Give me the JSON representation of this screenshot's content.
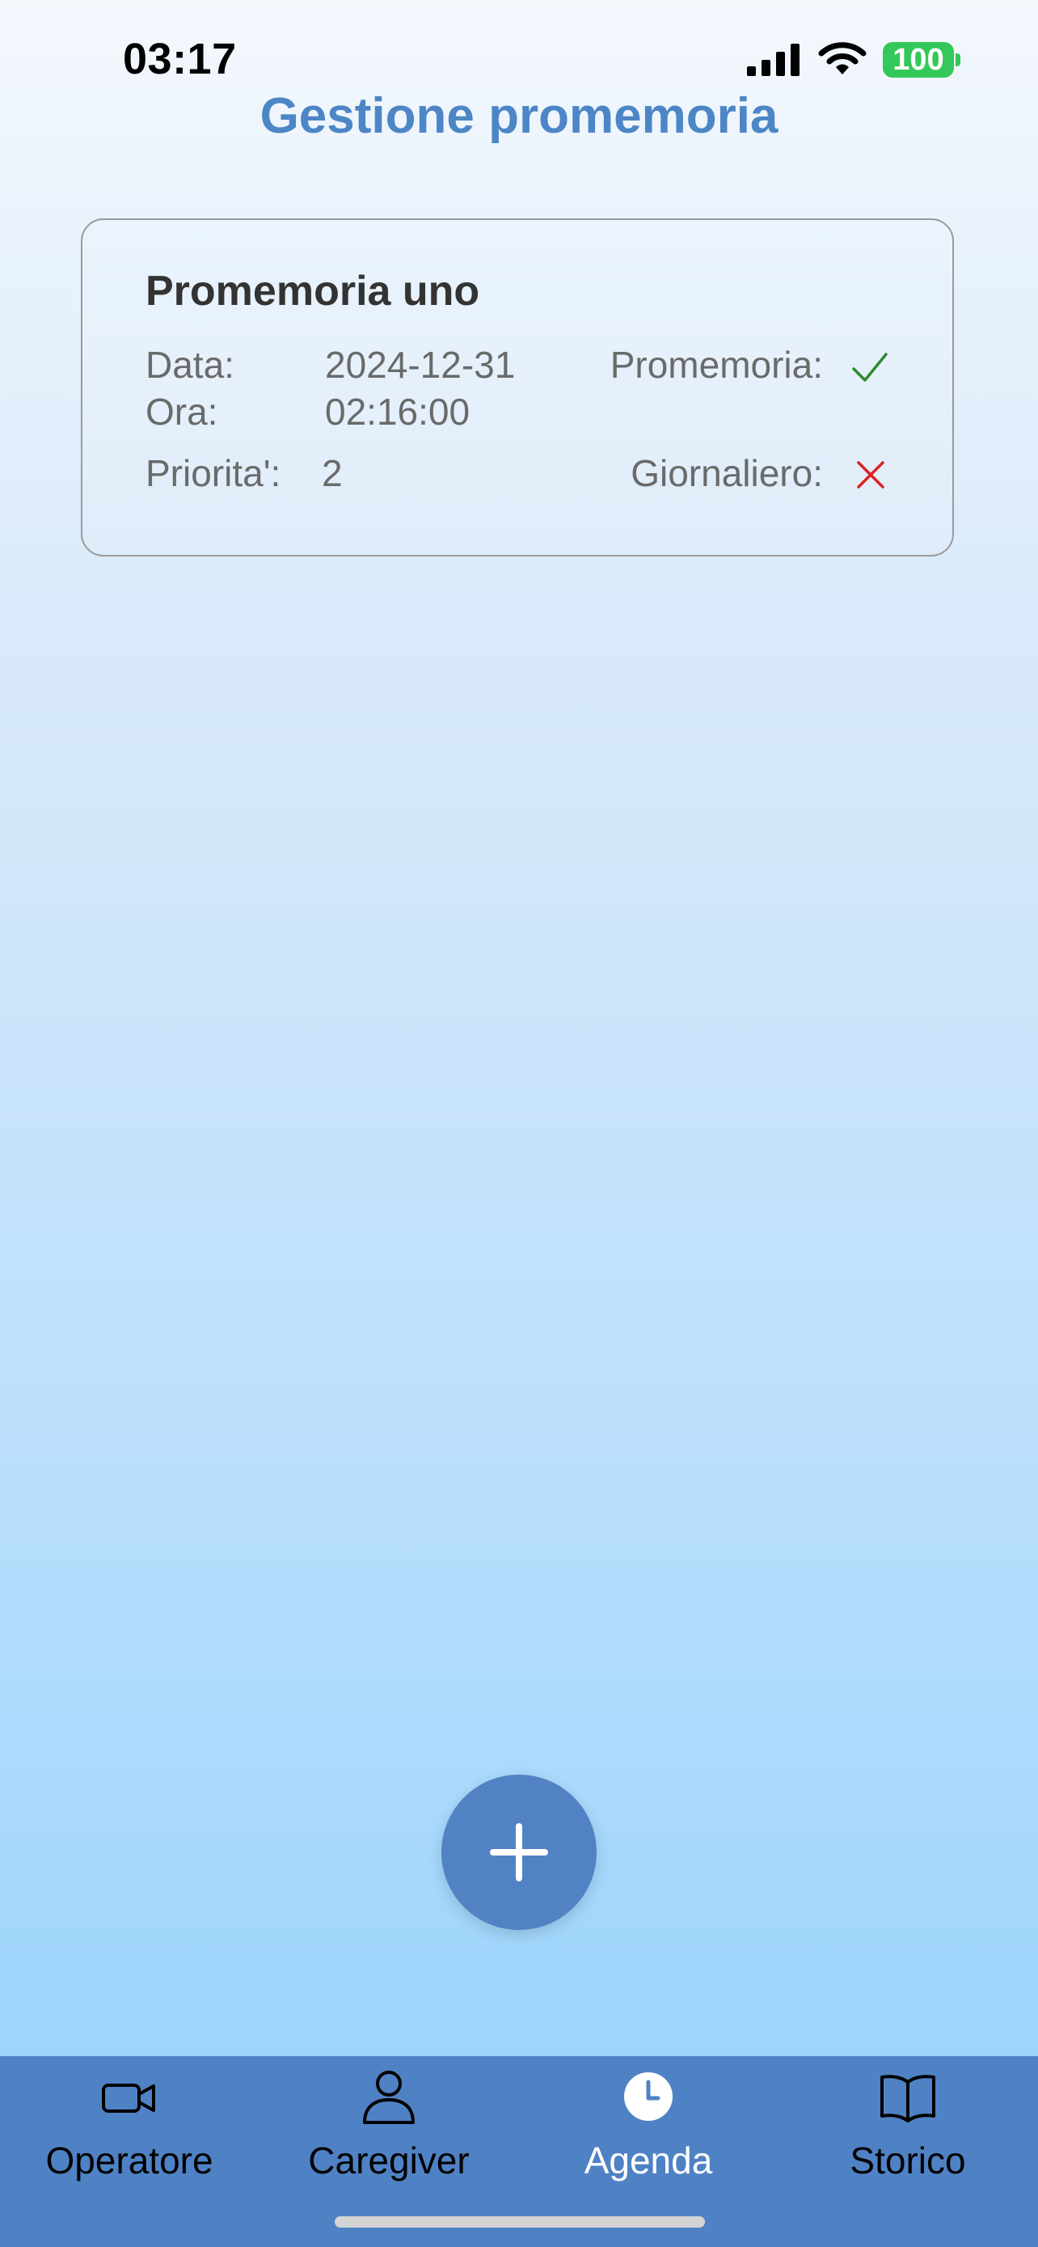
{
  "status_bar": {
    "time": "03:17",
    "battery": "100"
  },
  "header": {
    "title": "Gestione promemoria"
  },
  "reminder": {
    "title": "Promemoria uno",
    "data_label": "Data:",
    "data_value": "2024-12-31",
    "ora_label": "Ora:",
    "ora_value": "02:16:00",
    "priorita_label": "Priorita':",
    "priorita_value": "2",
    "promemoria_label": "Promemoria:",
    "promemoria_enabled": true,
    "giornaliero_label": "Giornaliero:",
    "giornaliero_enabled": false
  },
  "tabs": [
    {
      "label": "Operatore",
      "icon": "video-camera-icon"
    },
    {
      "label": "Caregiver",
      "icon": "person-icon"
    },
    {
      "label": "Agenda",
      "icon": "clock-icon",
      "active": true
    },
    {
      "label": "Storico",
      "icon": "book-icon"
    }
  ],
  "colors": {
    "accent": "#5082c4",
    "title": "#4c86c6",
    "check": "#2e8b2e",
    "cross": "#e02020"
  }
}
